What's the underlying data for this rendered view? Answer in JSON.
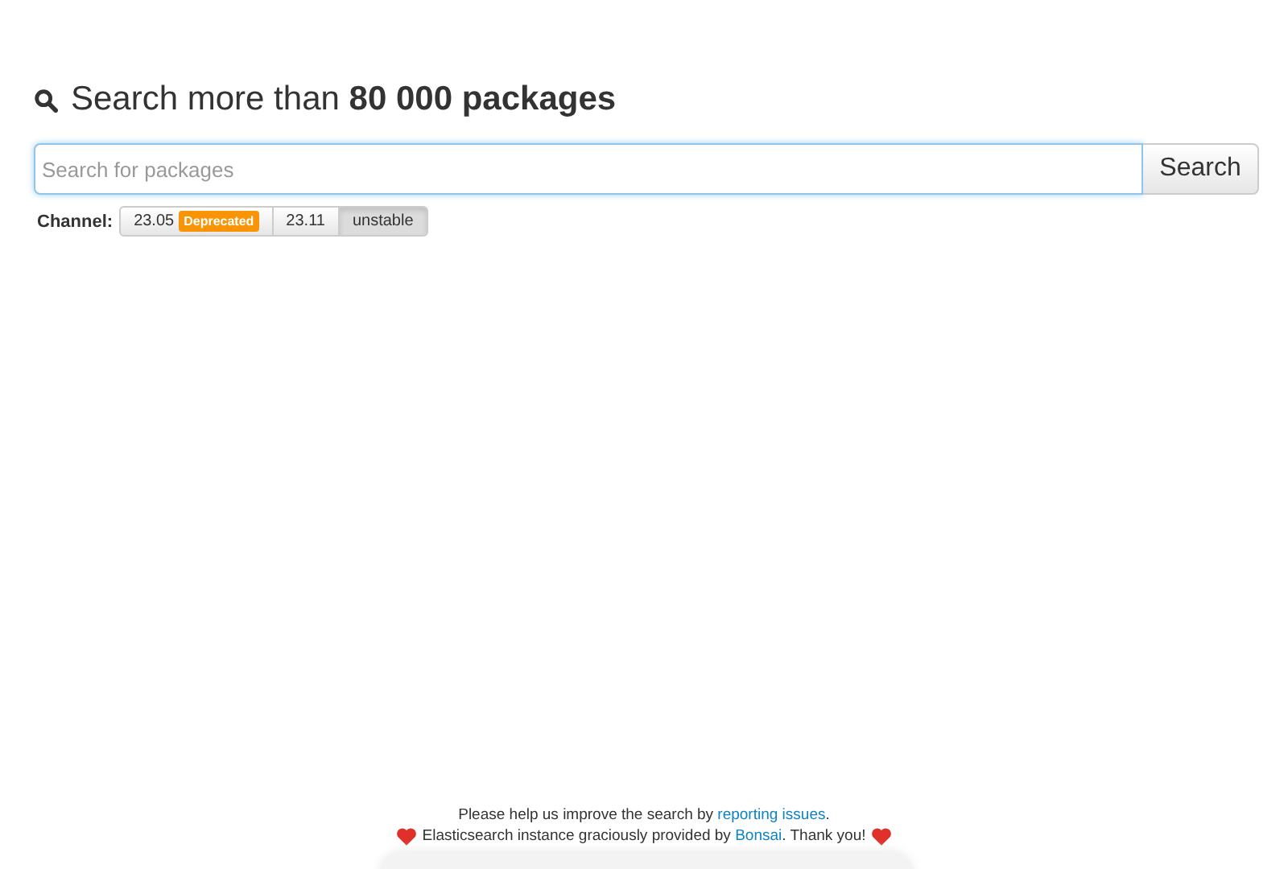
{
  "heading": "Search more than **80 000 packages**",
  "search": {
    "placeholder": "Search for packages",
    "button": "Search"
  },
  "channel": {
    "label": "Channel:",
    "options": [
      {
        "label": "23.05",
        "badge": "Deprecated",
        "selected": false
      },
      {
        "label": "23.11",
        "selected": false
      },
      {
        "label": "unstable",
        "selected": true
      }
    ]
  },
  "footer": {
    "line1": {
      "before": "Please help us improve the search by ",
      "link": "reporting issues",
      "after": "."
    },
    "line2": {
      "before": "Elasticsearch instance graciously provided by ",
      "link": "Bonsai",
      "after": ". Thank you!"
    }
  }
}
